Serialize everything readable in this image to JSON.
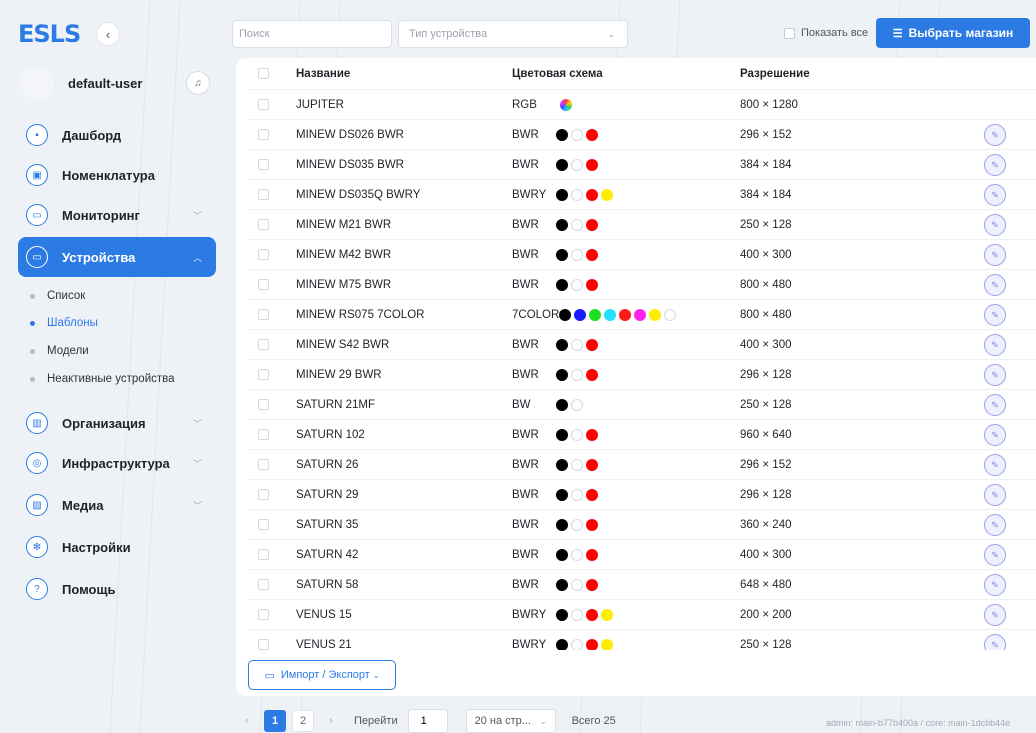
{
  "app": {
    "logo": "ESLS"
  },
  "sidebar": {
    "username": "default-user",
    "nav": [
      {
        "label": "Дашборд",
        "icon": "dashboard-icon",
        "glyph": "▪",
        "chevron": false,
        "active": false
      },
      {
        "label": "Номенклатура",
        "icon": "box-icon",
        "glyph": "▣",
        "chevron": false,
        "active": false
      },
      {
        "label": "Мониторинг",
        "icon": "monitor-icon",
        "glyph": "▭",
        "chevron": true,
        "active": false
      },
      {
        "label": "Устройства",
        "icon": "device-icon",
        "glyph": "▭",
        "chevron": true,
        "active": true
      },
      {
        "label": "Организация",
        "icon": "building-icon",
        "glyph": "▥",
        "chevron": true,
        "active": false
      },
      {
        "label": "Инфраструктура",
        "icon": "network-icon",
        "glyph": "◎",
        "chevron": true,
        "active": false
      },
      {
        "label": "Медиа",
        "icon": "image-icon",
        "glyph": "▨",
        "chevron": true,
        "active": false
      },
      {
        "label": "Настройки",
        "icon": "gear-icon",
        "glyph": "✻",
        "chevron": false,
        "active": false
      },
      {
        "label": "Помощь",
        "icon": "help-icon",
        "glyph": "?",
        "chevron": false,
        "active": false
      }
    ],
    "subitems": [
      {
        "label": "Список",
        "current": false
      },
      {
        "label": "Шаблоны",
        "current": true
      },
      {
        "label": "Модели",
        "current": false
      },
      {
        "label": "Неактивные устройства",
        "current": false
      }
    ]
  },
  "toolbar": {
    "search_placeholder": "Поиск",
    "type_placeholder": "Тип устройства",
    "show_all": "Показать все",
    "select_store": "Выбрать магазин"
  },
  "table": {
    "headers": {
      "name": "Название",
      "scheme": "Цветовая схема",
      "resolution": "Разрешение"
    },
    "rows": [
      {
        "name": "JUPITER",
        "scheme": "RGB",
        "colors": [
          "rgb"
        ],
        "resolution": "800 × 1280"
      },
      {
        "name": "MINEW DS026 BWR",
        "scheme": "BWR",
        "colors": [
          "#000000",
          "#ffffff",
          "#ff0000"
        ],
        "resolution": "296 × 152"
      },
      {
        "name": "MINEW DS035 BWR",
        "scheme": "BWR",
        "colors": [
          "#000000",
          "#ffffff",
          "#ff0000"
        ],
        "resolution": "384 × 184"
      },
      {
        "name": "MINEW DS035Q BWRY",
        "scheme": "BWRY",
        "colors": [
          "#000000",
          "#ffffff",
          "#ff0000",
          "#ffee00"
        ],
        "resolution": "384 × 184"
      },
      {
        "name": "MINEW M21 BWR",
        "scheme": "BWR",
        "colors": [
          "#000000",
          "#ffffff",
          "#ff0000"
        ],
        "resolution": "250 × 128"
      },
      {
        "name": "MINEW M42 BWR",
        "scheme": "BWR",
        "colors": [
          "#000000",
          "#ffffff",
          "#ff0000"
        ],
        "resolution": "400 × 300"
      },
      {
        "name": "MINEW M75 BWR",
        "scheme": "BWR",
        "colors": [
          "#000000",
          "#ffffff",
          "#ff0000"
        ],
        "resolution": "800 × 480"
      },
      {
        "name": "MINEW RS075 7COLOR",
        "scheme": "7COLOR",
        "colors": [
          "#000000",
          "#1a1aff",
          "#22dd22",
          "#22e0ff",
          "#ff1a1a",
          "#ff22ee",
          "#ffee00",
          "#ffffff"
        ],
        "resolution": "800 × 480"
      },
      {
        "name": "MINEW S42 BWR",
        "scheme": "BWR",
        "colors": [
          "#000000",
          "#ffffff",
          "#ff0000"
        ],
        "resolution": "400 × 300"
      },
      {
        "name": "MINEW 29 BWR",
        "scheme": "BWR",
        "colors": [
          "#000000",
          "#ffffff",
          "#ff0000"
        ],
        "resolution": "296 × 128"
      },
      {
        "name": "SATURN 21MF",
        "scheme": "BW",
        "colors": [
          "#000000",
          "#ffffff"
        ],
        "resolution": "250 × 128"
      },
      {
        "name": "SATURN 102",
        "scheme": "BWR",
        "colors": [
          "#000000",
          "#ffffff",
          "#ff0000"
        ],
        "resolution": "960 × 640"
      },
      {
        "name": "SATURN 26",
        "scheme": "BWR",
        "colors": [
          "#000000",
          "#ffffff",
          "#ff0000"
        ],
        "resolution": "296 × 152"
      },
      {
        "name": "SATURN 29",
        "scheme": "BWR",
        "colors": [
          "#000000",
          "#ffffff",
          "#ff0000"
        ],
        "resolution": "296 × 128"
      },
      {
        "name": "SATURN 35",
        "scheme": "BWR",
        "colors": [
          "#000000",
          "#ffffff",
          "#ff0000"
        ],
        "resolution": "360 × 240"
      },
      {
        "name": "SATURN 42",
        "scheme": "BWR",
        "colors": [
          "#000000",
          "#ffffff",
          "#ff0000"
        ],
        "resolution": "400 × 300"
      },
      {
        "name": "SATURN 58",
        "scheme": "BWR",
        "colors": [
          "#000000",
          "#ffffff",
          "#ff0000"
        ],
        "resolution": "648 × 480"
      },
      {
        "name": "VENUS 15",
        "scheme": "BWRY",
        "colors": [
          "#000000",
          "#ffffff",
          "#ff0000",
          "#ffee00"
        ],
        "resolution": "200 × 200"
      },
      {
        "name": "VENUS 21",
        "scheme": "BWRY",
        "colors": [
          "#000000",
          "#ffffff",
          "#ff0000",
          "#ffee00"
        ],
        "resolution": "250 × 128"
      }
    ],
    "import_export": "Импорт / Экспорт"
  },
  "pagination": {
    "pages": [
      "1",
      "2"
    ],
    "current": "1",
    "goto_label": "Перейти",
    "goto_value": "1",
    "per_page": "20 на стр...",
    "total": "Всего 25"
  },
  "footer": {
    "version": "admin: main-b77b400a / core: main-1dcbb44e"
  },
  "colors": {
    "accent": "#2c7be5",
    "edit": "#7f84e8"
  }
}
